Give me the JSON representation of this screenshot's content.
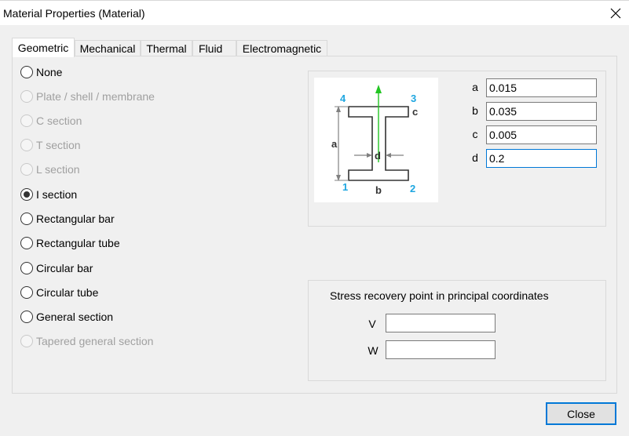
{
  "window": {
    "title": "Material Properties (Material)"
  },
  "tabs": [
    {
      "label": "Geometric",
      "active": true
    },
    {
      "label": "Mechanical",
      "active": false
    },
    {
      "label": "Thermal",
      "active": false
    },
    {
      "label": "Fluid",
      "active": false
    },
    {
      "label": "Electromagnetic",
      "active": false
    }
  ],
  "section_options": [
    {
      "label": "None",
      "checked": false,
      "enabled": true
    },
    {
      "label": "Plate / shell / membrane",
      "checked": false,
      "enabled": false
    },
    {
      "label": "C section",
      "checked": false,
      "enabled": false
    },
    {
      "label": "T section",
      "checked": false,
      "enabled": false
    },
    {
      "label": "L section",
      "checked": false,
      "enabled": false
    },
    {
      "label": "I section",
      "checked": true,
      "enabled": true
    },
    {
      "label": "Rectangular bar",
      "checked": false,
      "enabled": true
    },
    {
      "label": "Rectangular tube",
      "checked": false,
      "enabled": true
    },
    {
      "label": "Circular bar",
      "checked": false,
      "enabled": true
    },
    {
      "label": "Circular tube",
      "checked": false,
      "enabled": true
    },
    {
      "label": "General section",
      "checked": false,
      "enabled": true
    },
    {
      "label": "Tapered general section",
      "checked": false,
      "enabled": false
    }
  ],
  "diagram": {
    "dim_a": "a",
    "dim_b": "b",
    "dim_c": "c",
    "dim_d": "d",
    "point_1": "1",
    "point_2": "2",
    "point_3": "3",
    "point_4": "4",
    "colors": {
      "points": "#1ea6e0",
      "axis": "#22c522",
      "outline": "#333333"
    }
  },
  "params": [
    {
      "label": "a",
      "value": "0.015",
      "focused": false
    },
    {
      "label": "b",
      "value": "0.035",
      "focused": false
    },
    {
      "label": "c",
      "value": "0.005",
      "focused": false
    },
    {
      "label": "d",
      "value": "0.2",
      "focused": true
    }
  ],
  "stress_recovery": {
    "title": "Stress recovery point in principal coordinates",
    "v_label": "V",
    "w_label": "W",
    "v_value": "",
    "w_value": ""
  },
  "footer": {
    "close_label": "Close"
  },
  "icons": {
    "close": "close-icon"
  }
}
